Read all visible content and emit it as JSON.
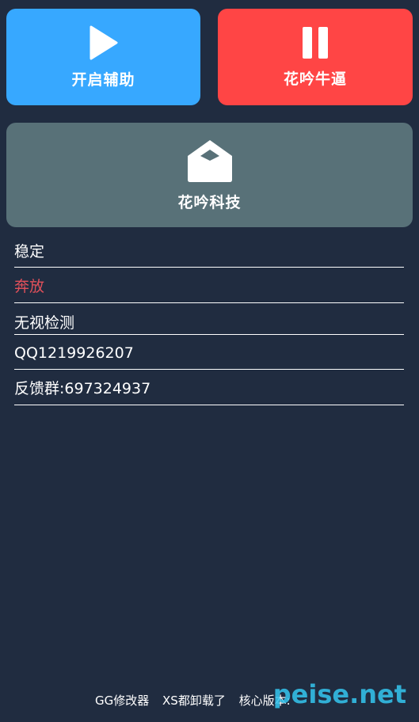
{
  "tiles": {
    "start": {
      "label": "开启辅助",
      "color": "#37a8ff",
      "icon": "play-icon"
    },
    "pause": {
      "label": "花吟牛逼",
      "color": "#ff4545",
      "icon": "pause-icon"
    },
    "info": {
      "label": "花吟科技",
      "color": "#587178",
      "icon": "envelope-open-icon"
    }
  },
  "list": [
    {
      "text": "稳定",
      "color": "#ffffff"
    },
    {
      "text": "奔放",
      "color": "#e0505a"
    },
    {
      "text": "无视检测",
      "color": "#ffffff"
    },
    {
      "text": "QQ1219926207",
      "color": "#ffffff"
    },
    {
      "text": "反馈群:697324937",
      "color": "#ffffff"
    }
  ],
  "footer": {
    "app": "GG修改器",
    "note": "XS都卸载了",
    "version_label": "核心版本:"
  },
  "watermark": "peise.net",
  "colors": {
    "background": "#202c40"
  }
}
